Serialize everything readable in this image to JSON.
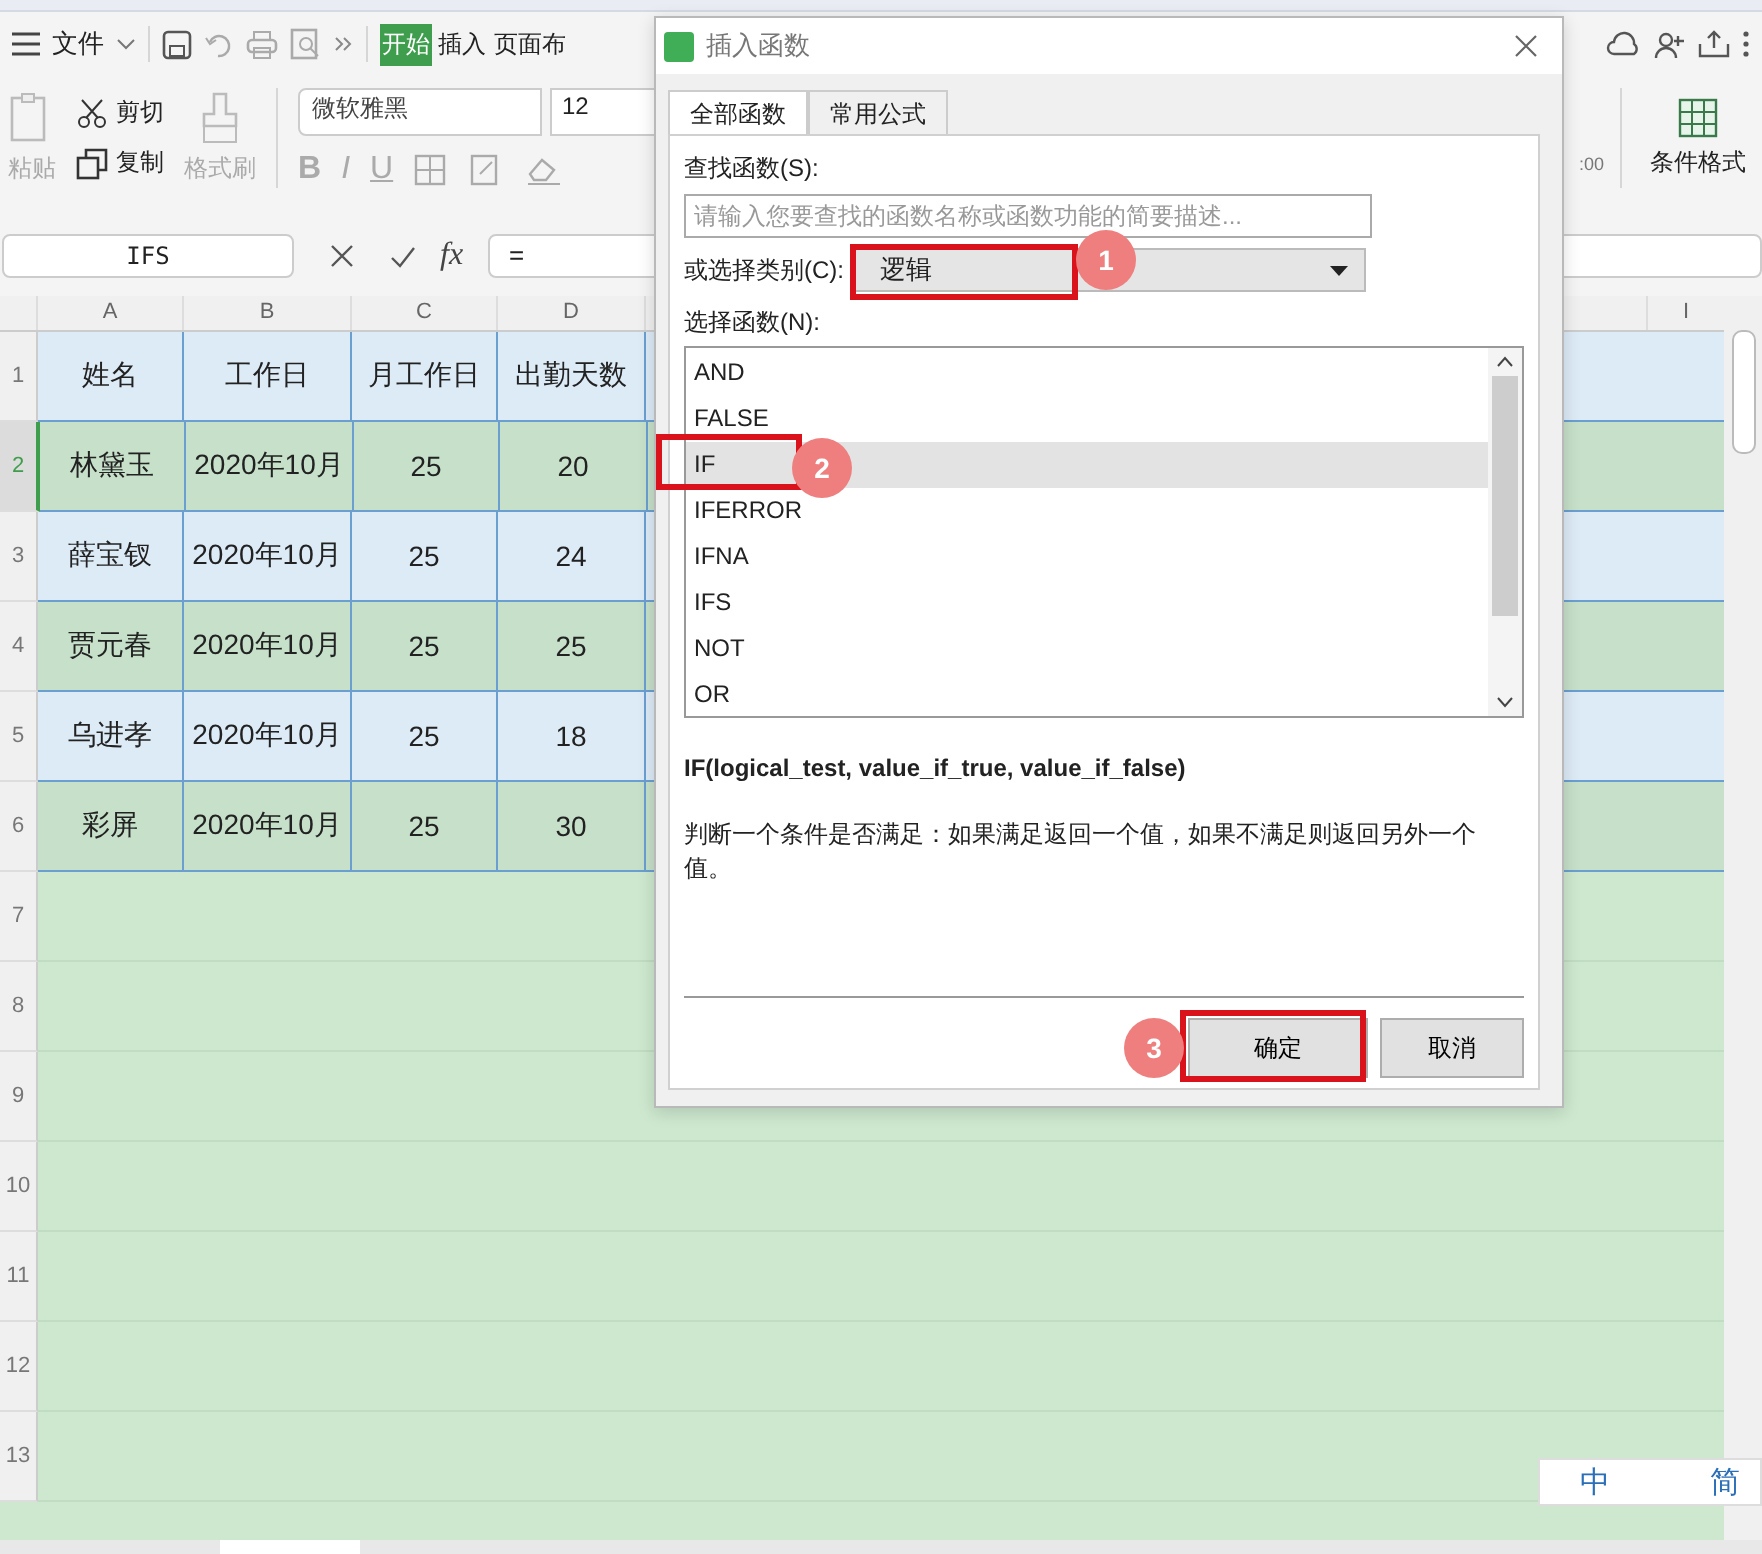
{
  "toolbar": {
    "menu_label": "文件",
    "tabs": [
      {
        "label": "开始",
        "selected": true
      },
      {
        "label": "插入",
        "selected": false
      },
      {
        "label": "页面布",
        "selected": false
      }
    ]
  },
  "ribbon": {
    "paste": "粘贴",
    "cut": "剪切",
    "copy": "复制",
    "format_painter": "格式刷",
    "font": "微软雅黑",
    "font_size": "12",
    "style_buttons": [
      "B",
      "I",
      "U"
    ],
    "number_format": [
      ":00"
    ],
    "conditional_format": "条件格式"
  },
  "formula_bar": {
    "name_box": "IFS",
    "fx": "fx",
    "formula": "="
  },
  "sheet": {
    "columns": [
      "A",
      "B",
      "C",
      "D"
    ],
    "far_column": "I",
    "rows": [
      {
        "number": "1",
        "selected": false,
        "color": "#ddebf7",
        "cells": [
          "姓名",
          "工作日",
          "月工作日",
          "出勤天数"
        ]
      },
      {
        "number": "2",
        "selected": true,
        "color": "#c6e0c9",
        "cells": [
          "林黛玉",
          "2020年10月",
          "25",
          "20"
        ]
      },
      {
        "number": "3",
        "selected": false,
        "color": "#ddebf7",
        "cells": [
          "薛宝钗",
          "2020年10月",
          "25",
          "24"
        ]
      },
      {
        "number": "4",
        "selected": false,
        "color": "#c6e0c9",
        "cells": [
          "贾元春",
          "2020年10月",
          "25",
          "25"
        ]
      },
      {
        "number": "5",
        "selected": false,
        "color": "#ddebf7",
        "cells": [
          "乌进孝",
          "2020年10月",
          "25",
          "18"
        ]
      },
      {
        "number": "6",
        "selected": false,
        "color": "#c6e0c9",
        "cells": [
          "彩屏",
          "2020年10月",
          "25",
          "30"
        ]
      }
    ],
    "empty_rows": [
      "7",
      "8",
      "9",
      "10",
      "11",
      "12",
      "13"
    ]
  },
  "dialog": {
    "title": "插入函数",
    "tabs": [
      {
        "label": "全部函数",
        "selected": true
      },
      {
        "label": "常用公式",
        "selected": false
      }
    ],
    "search_label": "查找函数(S):",
    "search_placeholder": "请输入您要查找的函数名称或函数功能的简要描述...",
    "category_label": "或选择类别(C):",
    "category_value": "逻辑",
    "list_label": "选择函数(N):",
    "functions": [
      {
        "name": "AND",
        "selected": false
      },
      {
        "name": "FALSE",
        "selected": false
      },
      {
        "name": "IF",
        "selected": true
      },
      {
        "name": "IFERROR",
        "selected": false
      },
      {
        "name": "IFNA",
        "selected": false
      },
      {
        "name": "IFS",
        "selected": false
      },
      {
        "name": "NOT",
        "selected": false
      },
      {
        "name": "OR",
        "selected": false
      }
    ],
    "signature": "IF(logical_test, value_if_true, value_if_false)",
    "description": "判断一个条件是否满足：如果满足返回一个值，如果不满足则返回另外一个值。",
    "buttons": [
      {
        "label": "确定",
        "kind": "ok"
      },
      {
        "label": "取消",
        "kind": "cancel"
      }
    ],
    "callouts": [
      "1",
      "2",
      "3"
    ]
  },
  "ime": {
    "items": [
      "中",
      "简"
    ]
  }
}
